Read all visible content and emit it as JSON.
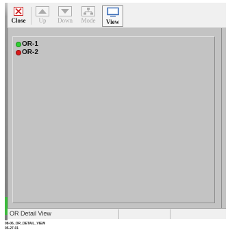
{
  "toolbar": {
    "buttons": [
      {
        "label": "Close",
        "icon": "close-x-icon",
        "enabled": true
      },
      {
        "label": "Up",
        "icon": "arrow-up-icon",
        "enabled": false
      },
      {
        "label": "Down",
        "icon": "arrow-down-icon",
        "enabled": false
      },
      {
        "label": "Mode",
        "icon": "mode-tree-icon",
        "enabled": false
      },
      {
        "label": "View",
        "icon": "monitor-view-icon",
        "enabled": true
      }
    ]
  },
  "list": {
    "items": [
      {
        "label": "OR-1",
        "status_color": "#2fd02f"
      },
      {
        "label": "OR-2",
        "status_color": "#d81818"
      }
    ]
  },
  "status_bar": {
    "text": "OR Detail View",
    "secondary": ""
  },
  "caption": {
    "line1": "08-06_OR_DETAIL_VIEW",
    "line2": "05-27-01"
  },
  "colors": {
    "panel_bg": "#c3c3c3",
    "close_red": "#cc2020",
    "view_blue": "#2a5fb0"
  }
}
